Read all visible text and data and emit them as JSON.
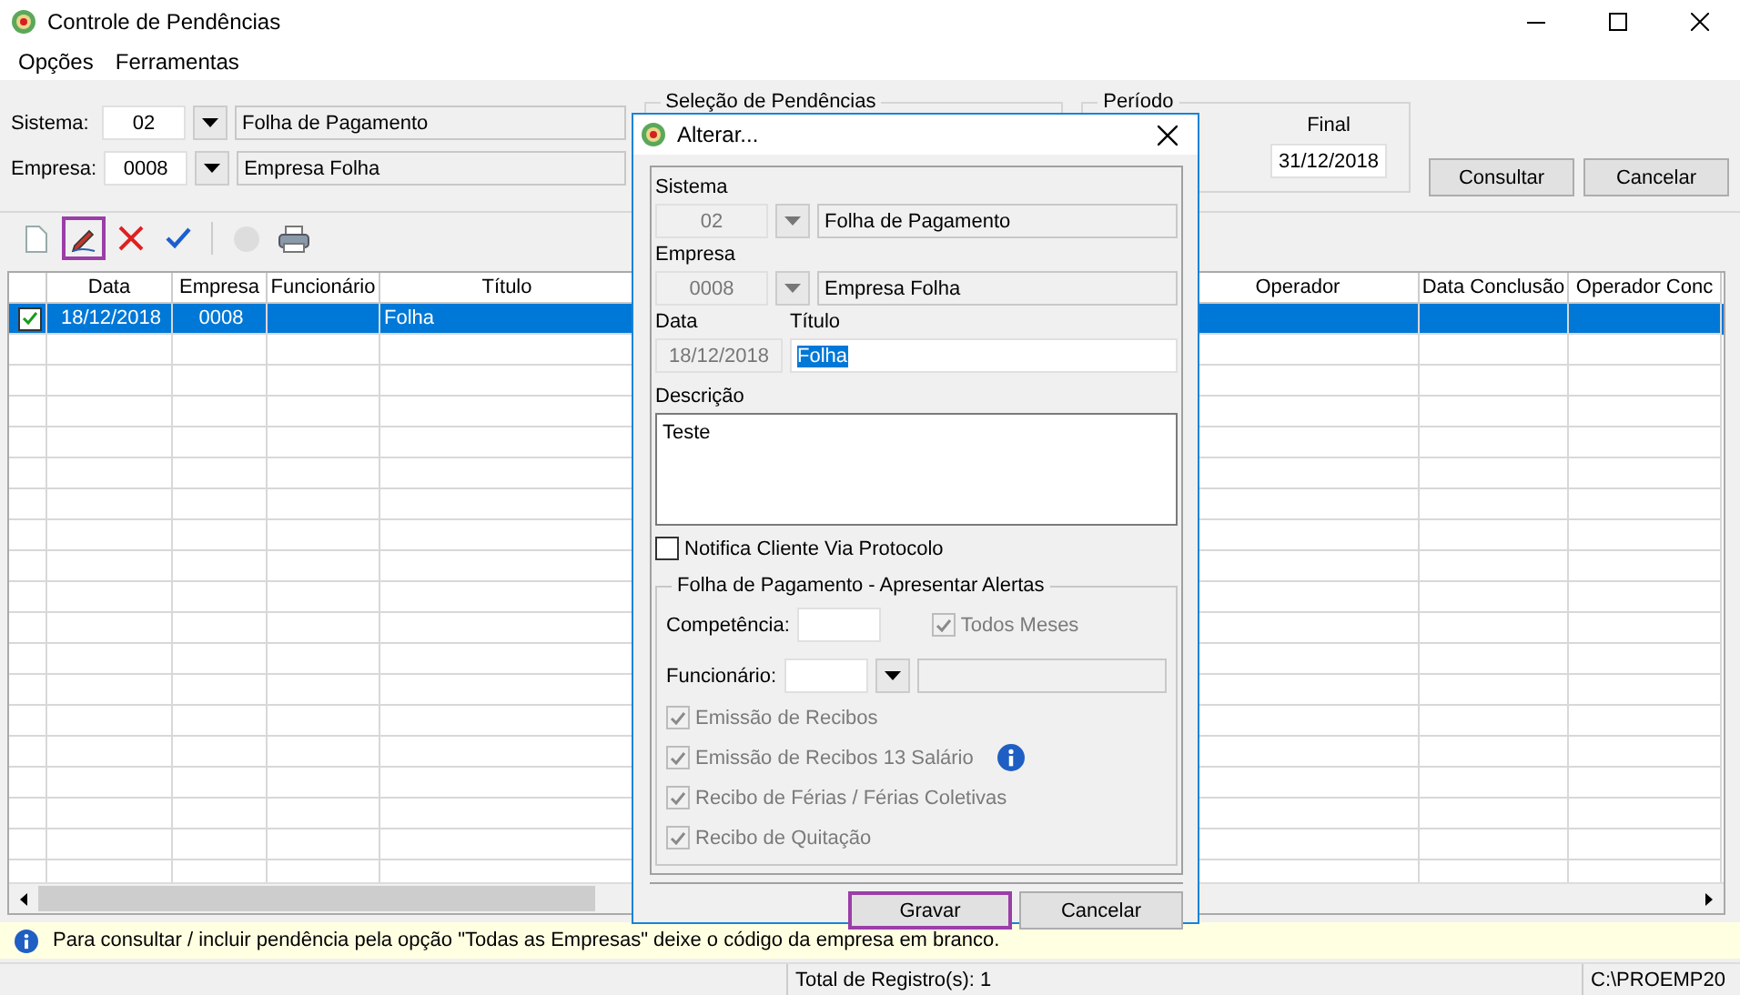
{
  "window": {
    "title": "Controle de Pendências"
  },
  "menu": [
    {
      "label": "Opções"
    },
    {
      "label": "Ferramentas"
    }
  ],
  "filters": [
    {
      "label": "Sistema:",
      "code": "02",
      "name": "Folha de Pagamento"
    },
    {
      "label": "Empresa:",
      "code": "0008",
      "name": "Empresa Folha"
    }
  ],
  "selection_group": {
    "legend": "Seleção de Pendências"
  },
  "period_group": {
    "legend": "Período",
    "final_label": "Final",
    "final_value": "31/12/2018"
  },
  "buttons": [
    {
      "label": "Consultar"
    },
    {
      "label": "Cancelar"
    }
  ],
  "toolbar": [
    {
      "kind": "new",
      "selected": false,
      "disabled": false
    },
    {
      "kind": "edit",
      "selected": true,
      "disabled": false
    },
    {
      "kind": "delete",
      "selected": false,
      "disabled": false
    },
    {
      "kind": "confirm",
      "selected": false,
      "disabled": false
    },
    {
      "kind": "separator"
    },
    {
      "kind": "globe",
      "selected": false,
      "disabled": true
    },
    {
      "kind": "print",
      "selected": false,
      "disabled": false
    }
  ],
  "table": {
    "columns": [
      {
        "label": "Data"
      },
      {
        "label": "Empresa"
      },
      {
        "label": "Funcionário"
      },
      {
        "label": "Título"
      },
      {
        "label": "Operador"
      },
      {
        "label": "Data Conclusão"
      },
      {
        "label": "Operador Conc"
      }
    ],
    "rows": [
      {
        "checked": true,
        "selected": true,
        "data": "18/12/2018",
        "empresa": "0008",
        "titulo": "Folha"
      }
    ]
  },
  "info": "Para consultar / incluir pendência pela opção \"Todas as Empresas\" deixe o código da empresa em branco.",
  "status_bar": {
    "total": "Total de Registro(s): 1",
    "path": "C:\\PROEMP20"
  },
  "dialog": {
    "title": "Alterar...",
    "lookups": [
      {
        "label": "Sistema",
        "code": "02",
        "name": "Folha de Pagamento",
        "disabled": true
      },
      {
        "label": "Empresa",
        "code": "0008",
        "name": "Empresa Folha",
        "disabled": true
      }
    ],
    "date_label": "Data",
    "date_value": "18/12/2018",
    "title_label": "Título",
    "title_value": "Folha",
    "description_label": "Descrição",
    "description_value": "Teste",
    "notify": {
      "label": "Notifica Cliente Via Protocolo",
      "checked": false,
      "disabled": false
    },
    "alerts": {
      "legend": "Folha de Pagamento - Apresentar Alertas",
      "competencia_label": "Competência:",
      "all_months": {
        "label": "Todos Meses",
        "checked": true,
        "disabled": true
      },
      "funcionario_label": "Funcionário:",
      "options": [
        {
          "label": "Emissão de Recibos",
          "checked": true,
          "disabled": true,
          "info": false
        },
        {
          "label": "Emissão de Recibos 13 Salário",
          "checked": true,
          "disabled": true,
          "info": true
        },
        {
          "label": "Recibo de Férias / Férias Coletivas",
          "checked": true,
          "disabled": true,
          "info": false
        },
        {
          "label": "Recibo de Quitação",
          "checked": true,
          "disabled": true,
          "info": false
        }
      ]
    },
    "buttons": [
      {
        "label": "Gravar",
        "focused": true
      },
      {
        "label": "Cancelar",
        "focused": false
      }
    ]
  }
}
